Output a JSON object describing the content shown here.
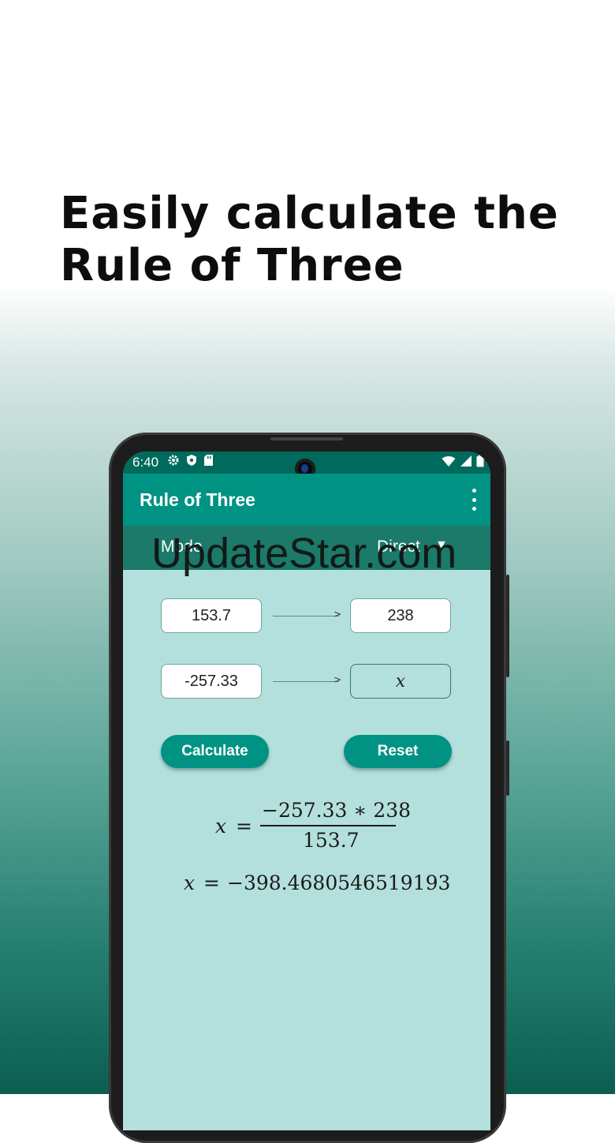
{
  "headline": {
    "line1": "Easily calculate the",
    "line2": "Rule of Three"
  },
  "status_bar": {
    "time": "6:40",
    "left_icons": [
      "gear-icon",
      "shield-icon",
      "sd-card-icon"
    ],
    "right_icons": [
      "wifi-icon",
      "signal-icon",
      "battery-icon"
    ]
  },
  "app_bar": {
    "title": "Rule of Three",
    "menu_icon": "more-vert-icon"
  },
  "mode_bar": {
    "label": "Mode",
    "value": "Direct",
    "dropdown_icon": "chevron-down-icon"
  },
  "inputs": {
    "a": "153.7",
    "b": "238",
    "c": "-257.33",
    "x": "x"
  },
  "buttons": {
    "calculate": "Calculate",
    "reset": "Reset"
  },
  "result": {
    "var": "x",
    "equals": "=",
    "numerator": "−257.33 ∗ 238",
    "denominator": "153.7",
    "value": "−398.4680546519193"
  },
  "watermark": "UpdateStar.com",
  "colors": {
    "primary": "#009383",
    "status_bar": "#006a5c",
    "mode_bar": "#1b7a69",
    "screen_bg": "#b3e0dc"
  }
}
